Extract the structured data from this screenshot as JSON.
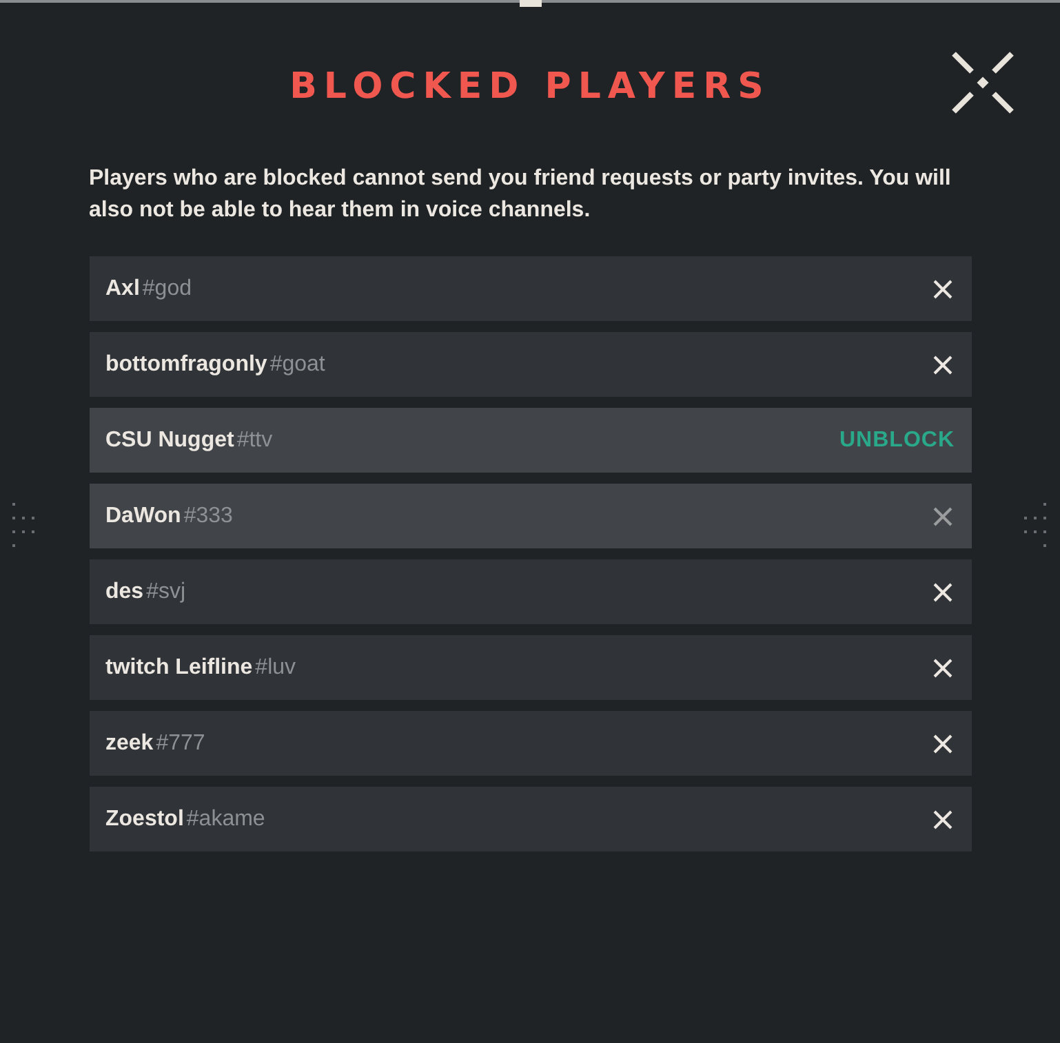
{
  "title": "BLOCKED PLAYERS",
  "description": "Players who are blocked cannot send you friend requests or party invites. You will also not be able to hear them in voice channels.",
  "players": [
    {
      "name": "Axl",
      "tag": "#god",
      "highlighted": false,
      "action": {
        "kind": "remove"
      }
    },
    {
      "name": "bottomfragonly",
      "tag": "#goat",
      "highlighted": false,
      "action": {
        "kind": "remove"
      }
    },
    {
      "name": "CSU Nugget",
      "tag": "#ttv",
      "highlighted": true,
      "action": {
        "kind": "unblock",
        "label": "UNBLOCK"
      }
    },
    {
      "name": "DaWon",
      "tag": "#333",
      "highlighted": true,
      "action": {
        "kind": "remove"
      }
    },
    {
      "name": "des",
      "tag": "#svj",
      "highlighted": false,
      "action": {
        "kind": "remove"
      }
    },
    {
      "name": "twitch Leifline",
      "tag": "#luv",
      "highlighted": false,
      "action": {
        "kind": "remove"
      }
    },
    {
      "name": "zeek",
      "tag": "#777",
      "highlighted": false,
      "action": {
        "kind": "remove"
      }
    },
    {
      "name": "Zoestol",
      "tag": "#akame",
      "highlighted": false,
      "action": {
        "kind": "remove"
      }
    }
  ]
}
